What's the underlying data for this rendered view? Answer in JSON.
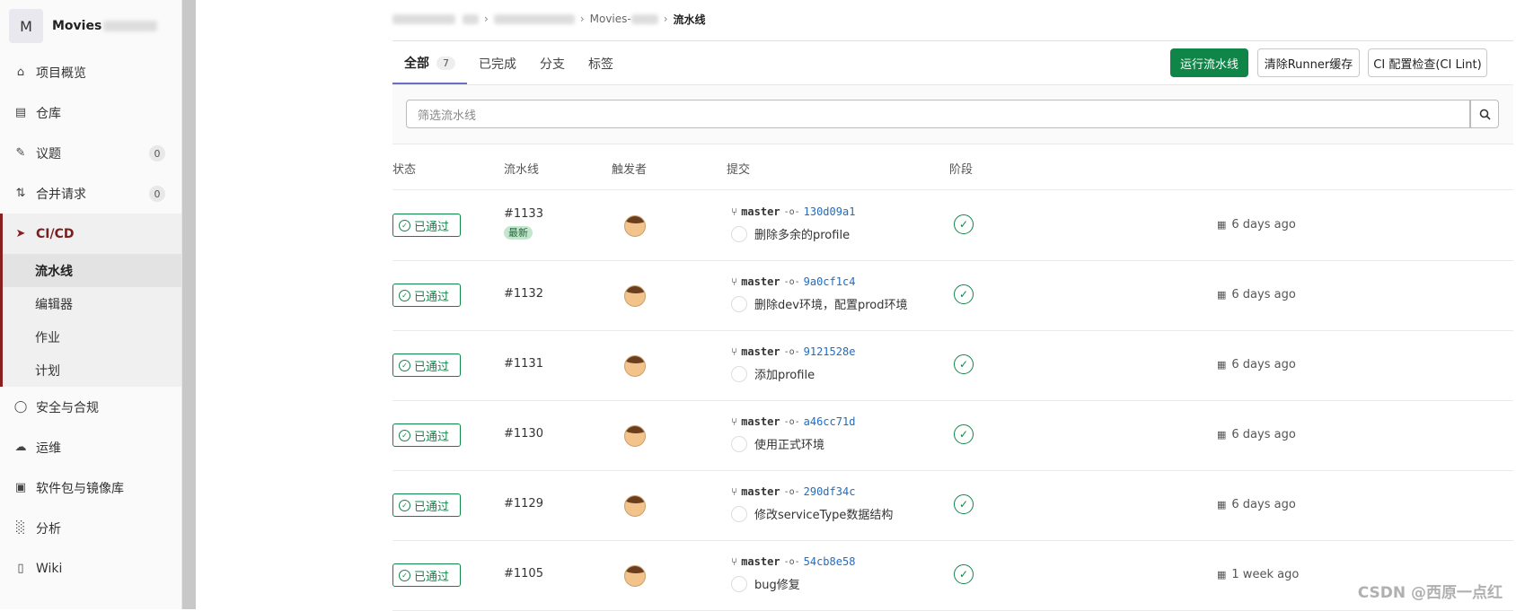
{
  "project": {
    "initial": "M",
    "name": "Movies"
  },
  "nav": {
    "items_top": [
      {
        "label": "项目概览",
        "icon": "home-icon"
      },
      {
        "label": "仓库",
        "icon": "document-icon"
      },
      {
        "label": "议题",
        "icon": "issues-icon",
        "count": "0"
      },
      {
        "label": "合并请求",
        "icon": "merge-request-icon",
        "count": "0"
      }
    ],
    "cicd": {
      "label": "CI/CD",
      "icon": "rocket-icon",
      "subitems": [
        "流水线",
        "编辑器",
        "作业",
        "计划"
      ],
      "active_subitem": "流水线"
    },
    "items_bottom": [
      {
        "label": "安全与合规",
        "icon": "shield-icon"
      },
      {
        "label": "运维",
        "icon": "cloud-icon"
      },
      {
        "label": "软件包与镜像库",
        "icon": "package-icon"
      },
      {
        "label": "分析",
        "icon": "chart-icon"
      },
      {
        "label": "Wiki",
        "icon": "book-icon"
      }
    ]
  },
  "breadcrumb": {
    "project": "Movies-",
    "current": "流水线"
  },
  "tabs": [
    {
      "label": "全部",
      "count": "7"
    },
    {
      "label": "已完成"
    },
    {
      "label": "分支"
    },
    {
      "label": "标签"
    }
  ],
  "buttons": {
    "run": "运行流水线",
    "clear_cache": "清除Runner缓存",
    "ci_lint": "CI 配置检查(CI Lint)"
  },
  "filter": {
    "placeholder": "筛选流水线"
  },
  "table": {
    "headers": [
      "状态",
      "流水线",
      "触发者",
      "提交",
      "阶段"
    ],
    "status_label": "已通过",
    "latest_label": "最新",
    "rows": [
      {
        "id": "#1133",
        "branch": "master",
        "sha": "130d09a1",
        "message": "删除多余的profile",
        "time": "6 days ago",
        "latest": true
      },
      {
        "id": "#1132",
        "branch": "master",
        "sha": "9a0cf1c4",
        "message": "删除dev环境，配置prod环境",
        "time": "6 days ago"
      },
      {
        "id": "#1131",
        "branch": "master",
        "sha": "9121528e",
        "message": "添加profile",
        "time": "6 days ago"
      },
      {
        "id": "#1130",
        "branch": "master",
        "sha": "a46cc71d",
        "message": "使用正式环境",
        "time": "6 days ago"
      },
      {
        "id": "#1129",
        "branch": "master",
        "sha": "290df34c",
        "message": "修改serviceType数据结构",
        "time": "6 days ago"
      },
      {
        "id": "#1105",
        "branch": "master",
        "sha": "54cb8e58",
        "message": "bug修复",
        "time": "1 week ago"
      }
    ]
  },
  "watermark": "CSDN @西原一点红",
  "colors": {
    "success": "#108548",
    "sidebar_accent": "#8a1f1f",
    "link": "#1f6cc2"
  }
}
